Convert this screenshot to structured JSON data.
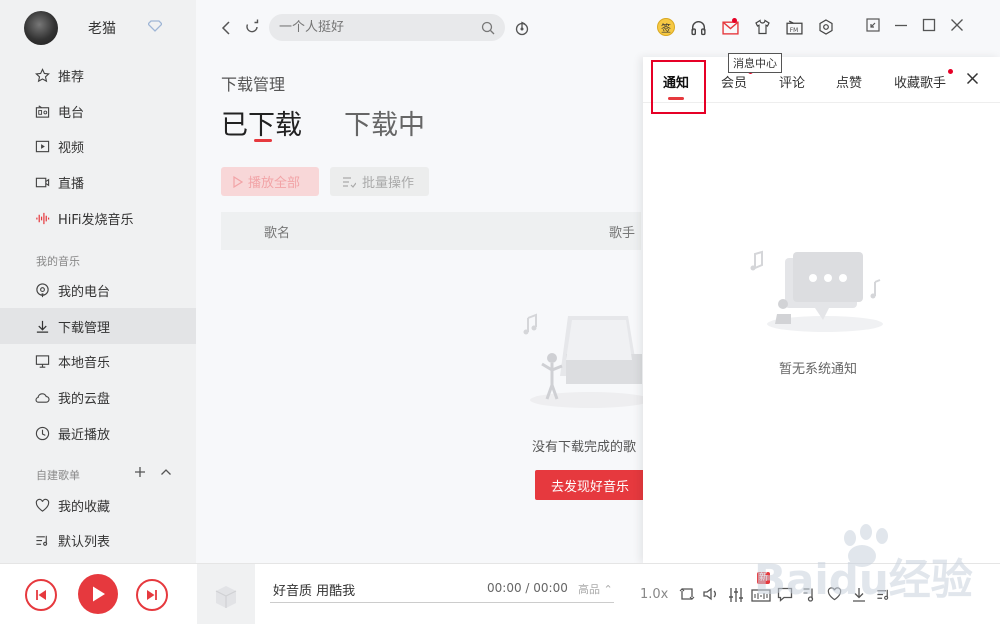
{
  "user": {
    "name": "老猫"
  },
  "sidebar": {
    "items": [
      {
        "label": "推荐"
      },
      {
        "label": "电台"
      },
      {
        "label": "视频"
      },
      {
        "label": "直播"
      },
      {
        "label": "HiFi发烧音乐"
      }
    ],
    "section_my_music": "我的音乐",
    "my_music": [
      {
        "label": "我的电台"
      },
      {
        "label": "下载管理"
      },
      {
        "label": "本地音乐"
      },
      {
        "label": "我的云盘"
      },
      {
        "label": "最近播放"
      }
    ],
    "section_playlists": "自建歌单",
    "playlists": [
      {
        "label": "我的收藏"
      },
      {
        "label": "默认列表"
      }
    ]
  },
  "search": {
    "placeholder": "一个人挺好"
  },
  "toolbar": {
    "sign_label": "签",
    "tooltip": "消息中心"
  },
  "main": {
    "subtitle": "下载管理",
    "tabs": [
      "已下载",
      "下载中"
    ],
    "play_all": "播放全部",
    "batch": "批量操作",
    "columns": [
      "歌名",
      "歌手"
    ],
    "empty_text": "没有下载完成的歌",
    "discover_button": "去发现好音乐"
  },
  "notification_panel": {
    "tabs": [
      "通知",
      "会员",
      "评论",
      "点赞",
      "收藏歌手"
    ],
    "empty_text": "暂无系统通知"
  },
  "player": {
    "song": "好音质 用酷我",
    "time": "00:00 / 00:00",
    "quality": "高品 ⌃",
    "rate": "1.0x",
    "new_badge": "新"
  },
  "watermark": {
    "text": "Baidu经验"
  },
  "colors": {
    "accent": "#e6393e",
    "sidebar_bg": "#f0f1f2",
    "main_bg": "#f7f8fa"
  }
}
